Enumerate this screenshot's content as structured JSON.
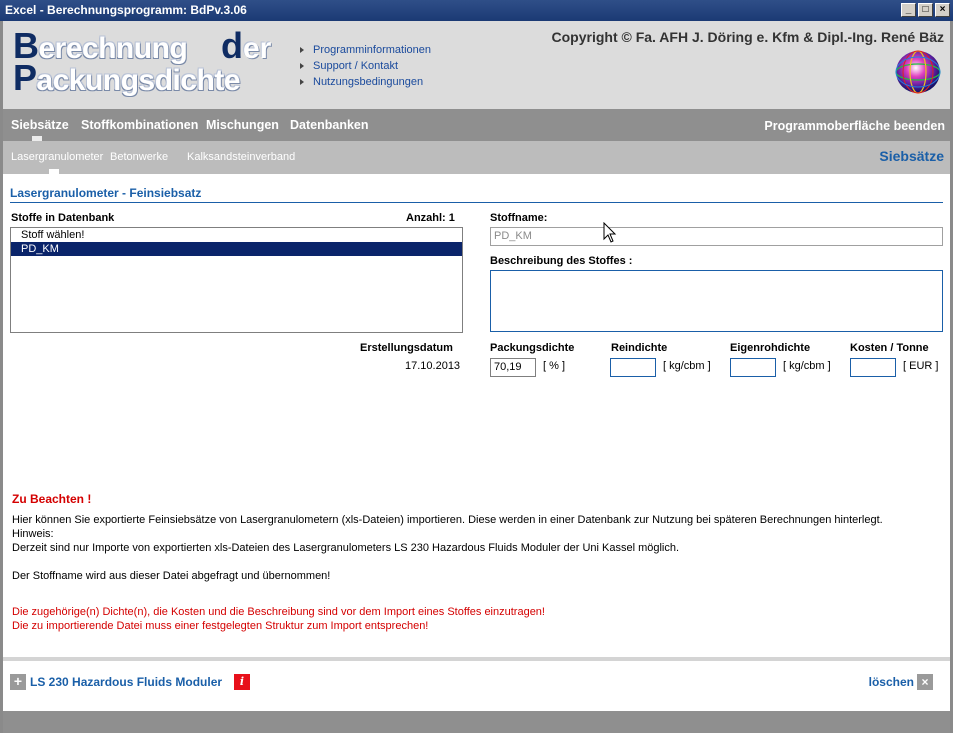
{
  "window": {
    "title": "Excel - Berechnungsprogramm: BdPv.3.06",
    "controls": {
      "minimize": "_",
      "maximize": "□",
      "close": "×"
    }
  },
  "header": {
    "logo": {
      "line1_cap": "B",
      "line1_rest": "erechnung",
      "der_cap": "d",
      "der_rest": "er",
      "line2_cap": "P",
      "line2_rest": "ackungsdichte"
    },
    "links": [
      "Programminformationen",
      "Support / Kontakt",
      "Nutzungsbedingungen"
    ],
    "copyright": "Copyright © Fa. AFH J. Döring e. Kfm & Dipl.-Ing. René Bäz"
  },
  "nav": {
    "items": [
      "Siebsätze",
      "Stoffkombinationen",
      "Mischungen",
      "Datenbanken"
    ],
    "active": "Siebsätze",
    "exit_label": "Programmoberfläche beenden"
  },
  "subnav": {
    "items": [
      "Lasergranulometer",
      "Betonwerke",
      "Kalksandsteinverband"
    ],
    "active": "Lasergranulometer",
    "section_label": "Siebsätze"
  },
  "content": {
    "title": "Lasergranulometer - Feinsiebsatz",
    "list_label": "Stoffe in Datenbank",
    "count_label": "Anzahl: 1",
    "list_items": [
      "Stoff wählen!",
      "PD_KM"
    ],
    "selected_item": "PD_KM",
    "stoffname_label": "Stoffname:",
    "stoffname_value": "PD_KM",
    "beschreibung_label": "Beschreibung des Stoffes :",
    "beschreibung_value": "",
    "erstellungsdatum_label": "Erstellungsdatum",
    "erstellungsdatum_value": "17.10.2013",
    "fields": [
      {
        "label": "Packungsdichte",
        "value": "70,19",
        "unit": "[ % ]"
      },
      {
        "label": "Reindichte",
        "value": "",
        "unit": "[ kg/cbm ]"
      },
      {
        "label": "Eigenrohdichte",
        "value": "",
        "unit": "[ kg/cbm ]"
      },
      {
        "label": "Kosten / Tonne",
        "value": "",
        "unit": "[ EUR ]"
      }
    ]
  },
  "notes": {
    "title": "Zu Beachten !",
    "lines": [
      "Hier können Sie exportierte Feinsiebsätze von Lasergranulometern (xls-Dateien) importieren. Diese werden in einer Datenbank zur Nutzung bei späteren Berechnungen hinterlegt.",
      "Hinweis:",
      "Derzeit sind nur Importe von exportierten xls-Dateien des Lasergranulometers  LS 230 Hazardous Fluids Moduler der Uni Kassel möglich.",
      "Der Stoffname wird aus dieser Datei abgefragt und übernommen!"
    ],
    "red_lines": [
      "Die zugehörige(n) Dichte(n), die Kosten und die Beschreibung sind vor dem Import eines Stoffes einzutragen!",
      "Die zu importierende Datei muss einer festgelegten Struktur zum Import entsprechen!"
    ]
  },
  "footer": {
    "plus": "+",
    "module_label": "LS 230 Hazardous Fluids Moduler",
    "info": "i",
    "delete_label": "löschen",
    "delete_icon": "×"
  },
  "colors": {
    "accent_blue": "#1a5fa8",
    "logo_navy": "#0f2c63",
    "warning_red": "#d40000",
    "nav_gray": "#8f8f8f",
    "selection": "#0a246a"
  }
}
